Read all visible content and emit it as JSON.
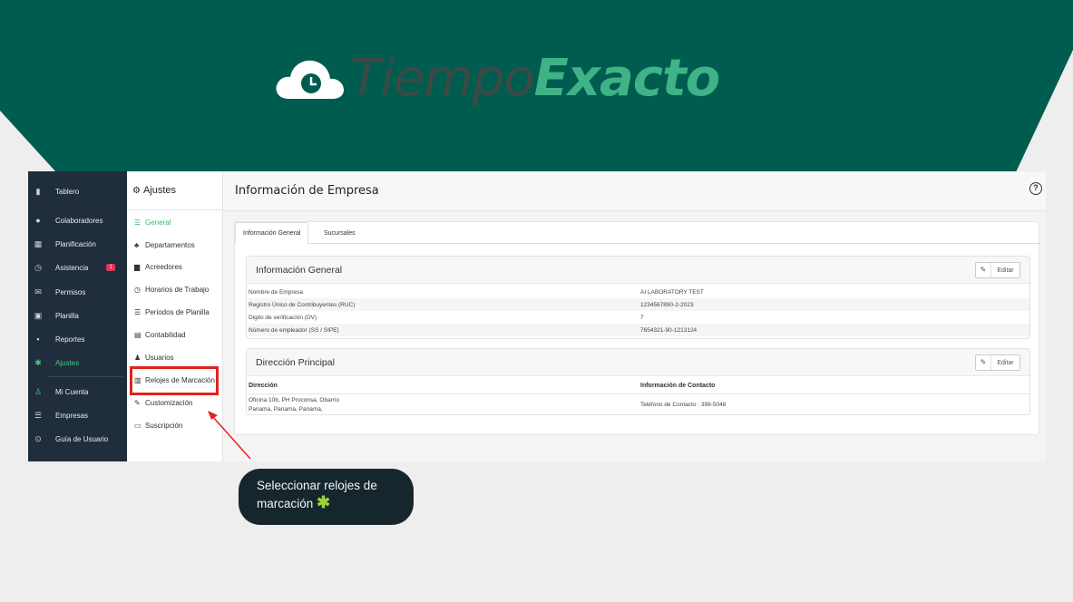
{
  "brand": {
    "part1": "Tiempo",
    "part2": "Exacto"
  },
  "sidebar": {
    "items": [
      {
        "icon": "bar-chart-icon",
        "label": "Tablero"
      },
      {
        "icon": "users-icon",
        "label": "Colaboradores"
      },
      {
        "icon": "calendar-icon",
        "label": "Planificación"
      },
      {
        "icon": "clock-icon",
        "label": "Asistencia",
        "badge": "1"
      },
      {
        "icon": "envelope-icon",
        "label": "Permisos"
      },
      {
        "icon": "money-icon",
        "label": "Planilla"
      },
      {
        "icon": "file-icon",
        "label": "Reportes"
      },
      {
        "icon": "gear-icon",
        "label": "Ajustes"
      },
      {
        "icon": "user-icon",
        "label": "Mi Cuenta"
      },
      {
        "icon": "sliders-icon",
        "label": "Empresas"
      },
      {
        "icon": "help-circle-icon",
        "label": "Guía de Usuario"
      }
    ]
  },
  "settings_menu": {
    "title": "Ajustes",
    "items": [
      {
        "icon": "list-icon",
        "label": "General"
      },
      {
        "icon": "sitemap-icon",
        "label": "Departamentos"
      },
      {
        "icon": "building-icon",
        "label": "Acreedores"
      },
      {
        "icon": "clock-icon",
        "label": "Horarios de Trabajo"
      },
      {
        "icon": "list-icon",
        "label": "Periodos de Planilla"
      },
      {
        "icon": "table-icon",
        "label": "Contabilidad"
      },
      {
        "icon": "user-icon",
        "label": "Usuarios"
      },
      {
        "icon": "fax-icon",
        "label": "Relojes de Marcación"
      },
      {
        "icon": "wrench-icon",
        "label": "Customización"
      },
      {
        "icon": "credit-card-icon",
        "label": "Suscripción"
      }
    ]
  },
  "main": {
    "title": "Información de Empresa",
    "tabs": [
      "Información General",
      "Sucursales"
    ],
    "general_panel": {
      "title": "Información General",
      "edit_label": "Editar",
      "rows": [
        {
          "label": "Nombre de Empresa",
          "value": "AI LABORATORY TEST"
        },
        {
          "label": "Registro Único de Contribuyentes (RUC)",
          "value": "1234567890-2-2023"
        },
        {
          "label": "Digito de verificación (DV)",
          "value": "7"
        },
        {
          "label": "Número de empleador (SS / SIPE)",
          "value": "7654321-90-1213124"
        }
      ]
    },
    "address_panel": {
      "title": "Dirección Principal",
      "edit_label": "Editar",
      "col_address": "Dirección",
      "col_contact": "Información de Contacto",
      "address_line1": "Oficina 10b, PH Proconsa, Obarrio",
      "address_line2": "Panama, Panama, Panama,",
      "contact": "Teléfono de Contacto : 399-5048"
    }
  },
  "callout": {
    "text": "Seleccionar relojes de marcación"
  },
  "colors": {
    "brand_dark": "#005c4f",
    "brand_green": "#3fb287",
    "highlight_red": "#e2231a",
    "sidebar_bg": "#1f2d3d"
  }
}
